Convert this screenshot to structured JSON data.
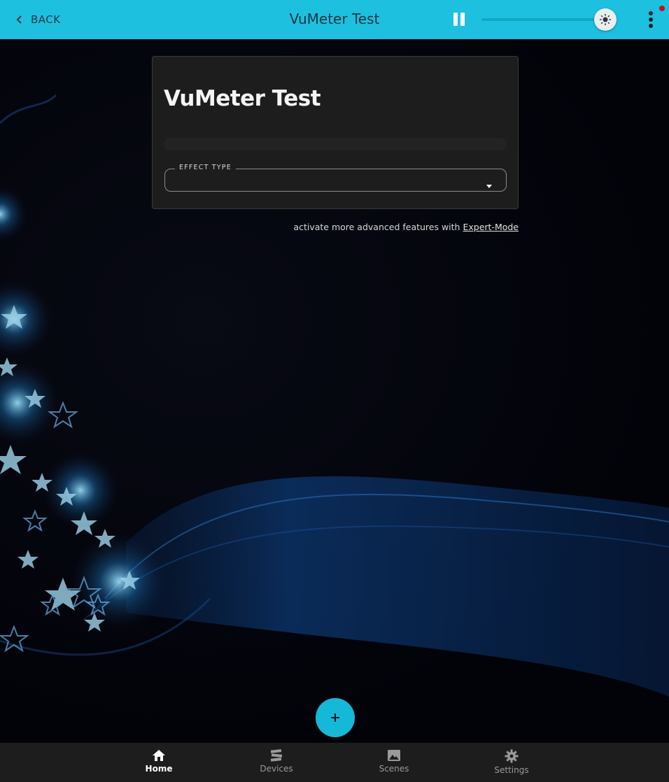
{
  "header": {
    "back_label": "BACK",
    "title": "VuMeter Test",
    "brightness_level": 0.95,
    "accent_color": "#1ec0e0",
    "notification_color": "#c1121c"
  },
  "card": {
    "title": "VuMeter Test",
    "effect_type_label": "EFFECT TYPE",
    "effect_type_value": ""
  },
  "expert": {
    "text": "activate more advanced features with",
    "link": "Expert-Mode"
  },
  "fab": {
    "icon": "plus-icon"
  },
  "bottom_nav": {
    "items": [
      {
        "label": "Home",
        "icon": "home-icon",
        "active": true
      },
      {
        "label": "Devices",
        "icon": "devices-icon",
        "active": false
      },
      {
        "label": "Scenes",
        "icon": "image-icon",
        "active": false
      },
      {
        "label": "Settings",
        "icon": "gear-icon",
        "active": false
      }
    ]
  }
}
